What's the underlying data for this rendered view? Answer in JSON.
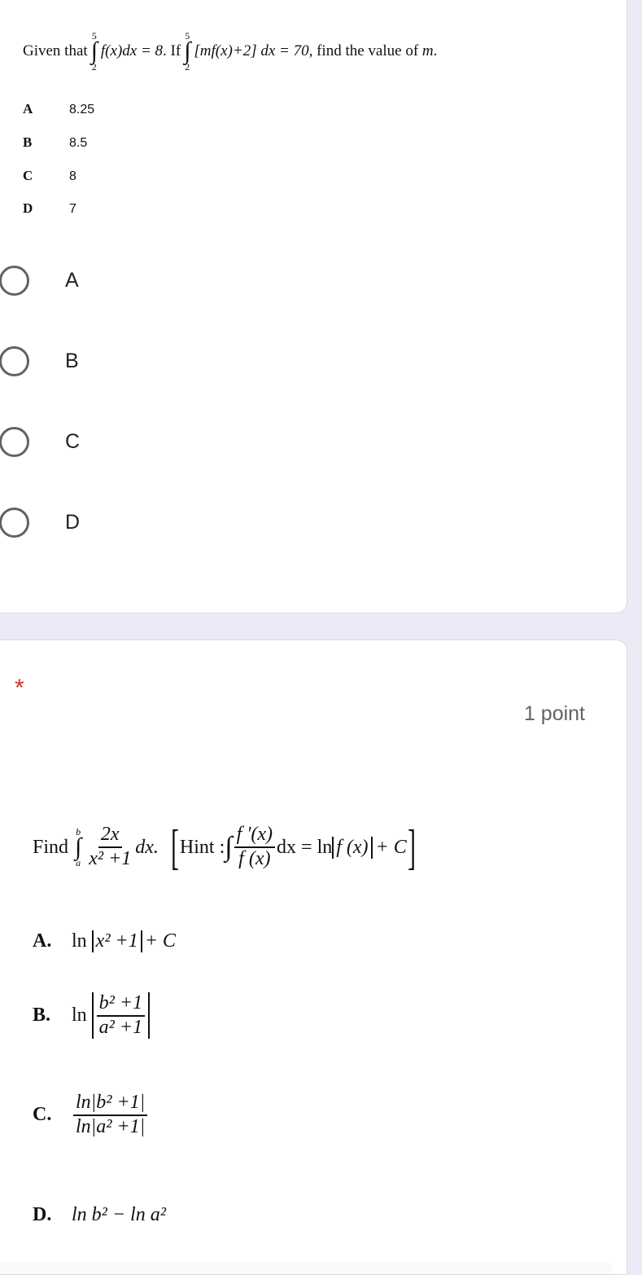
{
  "question1": {
    "text_prefix": "Given that",
    "int1": {
      "upper": "5",
      "lower": "2",
      "integrand": "f(x)dx = 8",
      "sign": "∫"
    },
    "text_mid": ". If",
    "int2": {
      "upper": "5",
      "lower": "2",
      "integrand": "[mf(x)+2] dx = 70,",
      "sign": "∫"
    },
    "text_suffix": "find the value of",
    "variable": "m",
    "period": ".",
    "choices": [
      {
        "letter": "A",
        "value": "8.25"
      },
      {
        "letter": "B",
        "value": "8.5"
      },
      {
        "letter": "C",
        "value": "8"
      },
      {
        "letter": "D",
        "value": "7"
      }
    ],
    "radio_options": [
      {
        "label": "A",
        "selected": false
      },
      {
        "label": "B",
        "selected": false
      },
      {
        "label": "C",
        "selected": false
      },
      {
        "label": "D",
        "selected": false
      }
    ]
  },
  "question2": {
    "required_marker": "*",
    "points": "1 point",
    "find_label": "Find",
    "integral": {
      "upper": "b",
      "lower": "a",
      "sign": "∫",
      "numerator": "2x",
      "denominator": "x² +1",
      "dx": "dx."
    },
    "hint": {
      "label": "Hint :",
      "sign": "∫",
      "numerator": "f '(x)",
      "denominator": "f (x)",
      "rhs": "dx = ln",
      "abs_content": "f (x)",
      "tail": "+ C",
      "open_bracket": "[",
      "close_bracket": "]"
    },
    "choices": [
      {
        "letter": "A.",
        "ln": "ln",
        "abs": "x² +1",
        "tail": "+ C"
      },
      {
        "letter": "B.",
        "ln": "ln",
        "numerator": "b² +1",
        "denominator": "a² +1"
      },
      {
        "letter": "C.",
        "numerator": "ln|b² +1|",
        "denominator": "ln|a² +1|"
      },
      {
        "letter": "D.",
        "expr": "ln b² − ln a²"
      }
    ]
  },
  "colors": {
    "background": "#ede9f7",
    "card": "#ffffff",
    "required": "#d93025",
    "radio": "#5f6368"
  }
}
